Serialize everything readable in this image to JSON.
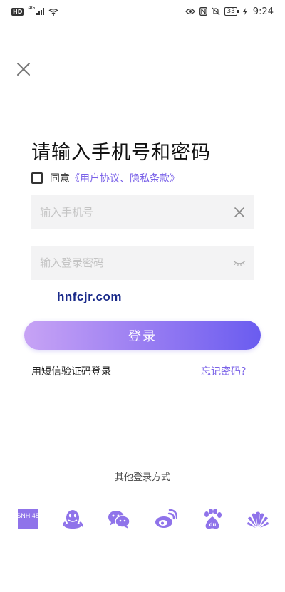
{
  "status_bar": {
    "hd": "HD",
    "network": "4G",
    "battery": "33",
    "time": "9:24"
  },
  "close_icon": "close-icon",
  "title": "请输入手机号和密码",
  "agreement": {
    "prefix": "同意",
    "link": "《用户协议、隐私条款》",
    "checked": false
  },
  "phone_field": {
    "placeholder": "输入手机号",
    "value": "",
    "clear_icon": "clear-icon"
  },
  "password_field": {
    "placeholder": "输入登录密码",
    "value": "",
    "visibility_icon": "eye-closed-icon"
  },
  "watermark": "hnfcjr.com",
  "login_button": "登录",
  "sms_login": "用短信验证码登录",
  "forgot_password": "忘记密码？",
  "other_login_title": "其他登录方式",
  "social": [
    {
      "name": "snh48",
      "icon": "snh48-icon",
      "label": "SNH 48"
    },
    {
      "name": "qq",
      "icon": "qq-icon"
    },
    {
      "name": "wechat",
      "icon": "wechat-icon"
    },
    {
      "name": "weibo",
      "icon": "weibo-icon"
    },
    {
      "name": "baidu",
      "icon": "baidu-icon",
      "label": "du"
    },
    {
      "name": "huawei",
      "icon": "huawei-icon"
    }
  ],
  "colors": {
    "accent": "#7a62e8",
    "button_gradient_start": "#c7a3f5",
    "button_gradient_end": "#6a5cf0",
    "input_bg": "#f3f3f4",
    "watermark": "#1a2a8a"
  }
}
